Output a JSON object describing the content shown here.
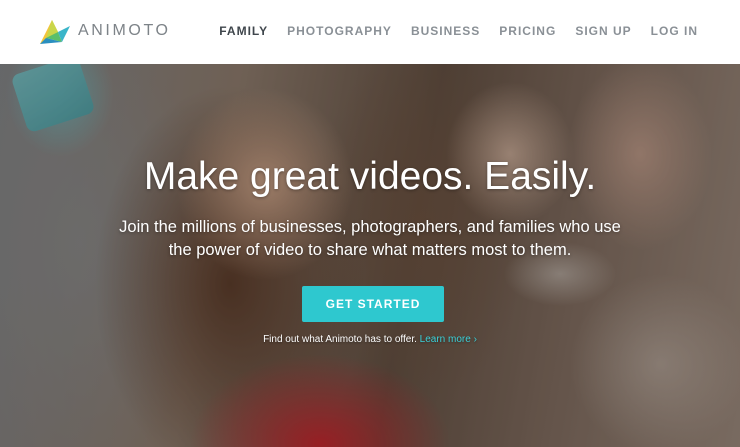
{
  "brand": {
    "name": "ANIMOTO",
    "icon": "animoto-logo-mark",
    "colors": [
      "#f3c43b",
      "#5bbf6a",
      "#3ab5c9",
      "#2a8fbf"
    ]
  },
  "nav": {
    "items": [
      {
        "label": "FAMILY",
        "active": true
      },
      {
        "label": "PHOTOGRAPHY",
        "active": false
      },
      {
        "label": "BUSINESS",
        "active": false
      },
      {
        "label": "PRICING",
        "active": false
      },
      {
        "label": "SIGN UP",
        "active": false
      },
      {
        "label": "LOG IN",
        "active": false
      }
    ]
  },
  "hero": {
    "headline": "Make great videos. Easily.",
    "subhead_line1": "Join the millions of businesses, photographers, and families who use",
    "subhead_line2": "the power of video to share what matters most to them.",
    "cta_label": "GET STARTED",
    "offer_text": "Find out what Animoto has to offer.",
    "learn_more": "Learn more ›"
  },
  "colors": {
    "accent": "#2ec8cf",
    "nav_active": "#3f464c",
    "nav_inactive": "#8a9096"
  }
}
